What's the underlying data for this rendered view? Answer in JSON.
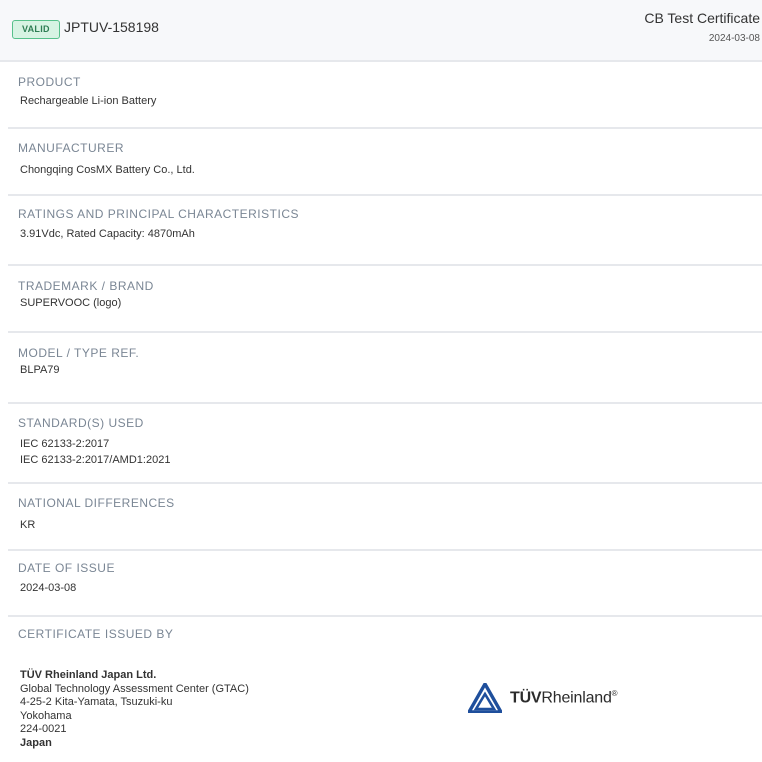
{
  "header": {
    "status_badge": "VALID",
    "certificate_number": "JPTUV-158198",
    "document_type": "CB Test Certificate",
    "document_date": "2024-03-08"
  },
  "sections": {
    "product": {
      "label": "PRODUCT",
      "value": "Rechargeable Li-ion Battery"
    },
    "manufacturer": {
      "label": "MANUFACTURER",
      "value": "Chongqing CosMX Battery Co., Ltd."
    },
    "ratings": {
      "label": "RATINGS AND PRINCIPAL CHARACTERISTICS",
      "value": "3.91Vdc, Rated Capacity: 4870mAh"
    },
    "trademark": {
      "label": "TRADEMARK / BRAND",
      "value": "SUPERVOOC (logo)"
    },
    "model": {
      "label": "MODEL / TYPE REF.",
      "value": "BLPA79"
    },
    "standards": {
      "label": "STANDARD(S) USED",
      "values": [
        "IEC 62133-2:2017",
        "IEC 62133-2:2017/AMD1:2021"
      ]
    },
    "national_differences": {
      "label": "NATIONAL DIFFERENCES",
      "value": "KR"
    },
    "date_of_issue": {
      "label": "DATE OF ISSUE",
      "value": "2024-03-08"
    },
    "issued_by": {
      "label": "CERTIFICATE ISSUED BY",
      "name": "TÜV Rheinland Japan Ltd.",
      "address_lines": [
        "Global Technology Assessment Center (GTAC)",
        "4-25-2 Kita-Yamata, Tsuzuki-ku",
        "Yokohama",
        "224-0021"
      ],
      "country": "Japan",
      "logo": {
        "icon": "tuv-triangle-logo-icon",
        "text_prefix": "TÜV",
        "text_suffix": "Rheinland",
        "mark": "®",
        "color": "#1f4f9c"
      }
    }
  }
}
